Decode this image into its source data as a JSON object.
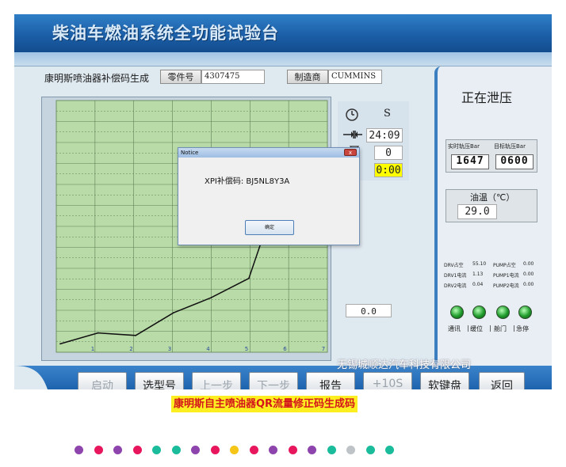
{
  "window": {
    "title": "柴油车燃油系统全功能试验台"
  },
  "header": {
    "heading": "康明斯喷油器补偿码生成",
    "part_no_label": "零件号",
    "part_no_value": "4307475",
    "maker_label": "制造商",
    "maker_value": "CUMMINS"
  },
  "chart_data": {
    "type": "line",
    "x": [
      0,
      1,
      2,
      3,
      4,
      5,
      6
    ],
    "y": [
      1.0,
      2.3,
      2.0,
      4.7,
      6.5,
      8.8,
      22.0
    ],
    "x_ticks": [
      "1",
      "2",
      "3",
      "4",
      "5",
      "6",
      "7"
    ],
    "ylim": [
      0,
      30
    ],
    "grid": true,
    "title": "",
    "xlabel": "",
    "ylabel": ""
  },
  "indicators": {
    "unit_s": "S",
    "time_value": "24:09",
    "count_value": "0",
    "yellow_value": "0:00",
    "readout": "0.0"
  },
  "right_panel": {
    "status": "正在泄压",
    "rail_real_label": "实时轨压Bar",
    "rail_target_label": "目标轨压Bar",
    "rail_real_value": "1647",
    "rail_target_value": "0600",
    "oil_temp_label": "油温（℃）",
    "oil_temp_value": "29.0",
    "params": [
      {
        "label": "DRV占空",
        "value": "55.10",
        "label2": "PUMP占空",
        "value2": "0.00"
      },
      {
        "label": "DRV1电流",
        "value": "1.13",
        "label2": "PUMP1电流",
        "value2": "0.00"
      },
      {
        "label": "DRV2电流",
        "value": "0.04",
        "label2": "PUMP2电流",
        "value2": "0.00"
      }
    ],
    "lights": [
      "通讯",
      "缓位",
      "舱门",
      "急停"
    ],
    "light_separator": "|"
  },
  "bottom_buttons": [
    "启动",
    "选型号",
    "上一步",
    "下一步",
    "报告",
    "+10S",
    "软键盘",
    "返回"
  ],
  "dialog": {
    "title": "Notice",
    "close_glyph": "x",
    "message": "XPI补偿码: BJ5NL8Y3A",
    "ok": "确定"
  },
  "watermark": "无锡城顺达汽车科技有限公司",
  "caption": "康明斯自主喷油器QR流量修正码生成码",
  "dot_colors": [
    "#8e44ad",
    "#e8175d",
    "#8e44ad",
    "#e8175d",
    "#1abc9c",
    "#1abc9c",
    "#8e44ad",
    "#e8175d",
    "#f5c518",
    "#e8175d",
    "#8e44ad",
    "#e8175d",
    "#8e44ad",
    "#1abc9c",
    "#bdc3c7",
    "#1abc9c",
    "#1abc9c"
  ],
  "colors": {
    "accent": "#1b5fa8",
    "plot_bg": "#b9dba8",
    "status_green": "#1f9b2b",
    "yellow_value_bg": "#ffff00"
  }
}
